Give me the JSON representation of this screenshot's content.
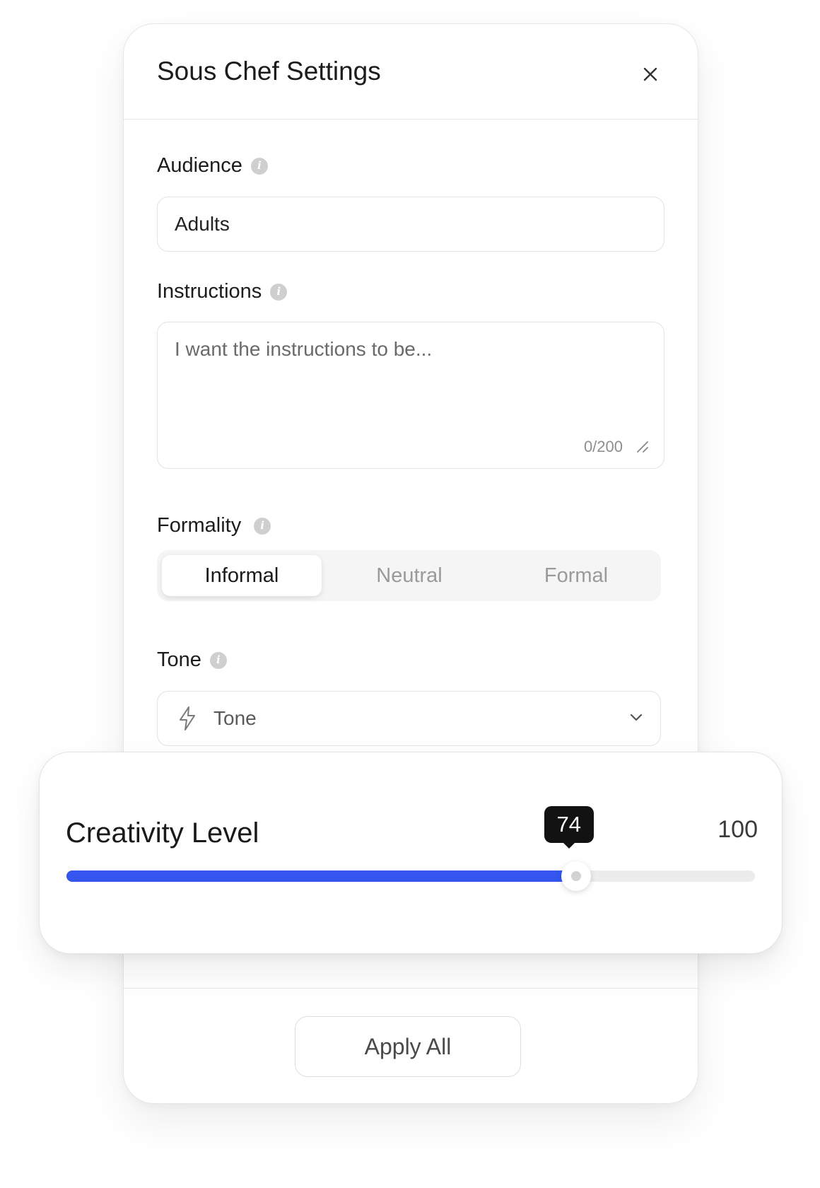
{
  "panel": {
    "title": "Sous Chef Settings",
    "close_icon": "close-icon"
  },
  "audience": {
    "label": "Audience",
    "value": "Adults"
  },
  "instructions": {
    "label": "Instructions",
    "placeholder": "I want the instructions to be...",
    "counter": "0/200"
  },
  "formality": {
    "label": "Formality",
    "options": [
      "Informal",
      "Neutral",
      "Formal"
    ],
    "selected": "Informal"
  },
  "tone": {
    "label": "Tone",
    "placeholder": "Tone",
    "icon": "bolt-icon"
  },
  "creativity": {
    "label": "Creativity Level",
    "value": 74,
    "max": 100,
    "value_text": "74",
    "max_text": "100",
    "fill_color": "#3456ee"
  },
  "footer": {
    "apply_label": "Apply All"
  }
}
